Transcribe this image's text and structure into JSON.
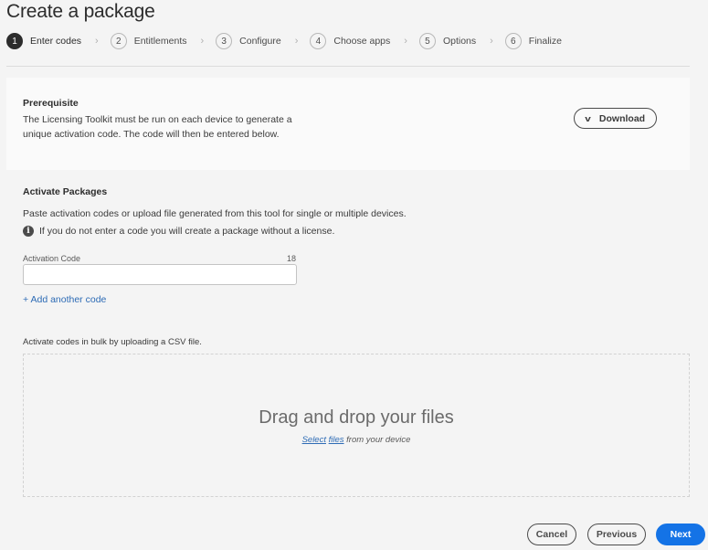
{
  "page": {
    "title": "Create a package"
  },
  "steps": [
    {
      "number": "1",
      "label": "Enter codes",
      "active": true
    },
    {
      "number": "2",
      "label": "Entitlements",
      "active": false
    },
    {
      "number": "3",
      "label": "Configure",
      "active": false
    },
    {
      "number": "4",
      "label": "Choose apps",
      "active": false
    },
    {
      "number": "5",
      "label": "Options",
      "active": false
    },
    {
      "number": "6",
      "label": "Finalize",
      "active": false
    }
  ],
  "step_separator": "›",
  "prerequisite": {
    "title": "Prerequisite",
    "text": "The Licensing Toolkit must be run on each device to generate a unique activation code. The code will then be entered below.",
    "download_icon": "chevron-down-icon",
    "download_label": "Download"
  },
  "activate": {
    "title": "Activate Packages",
    "description": "Paste activation codes or upload file generated from this tool for single or multiple devices.",
    "info_icon": "info-icon",
    "info_text": "If you do not enter a code you will create a package without a license.",
    "field_label": "Activation Code",
    "field_count": "18",
    "field_value": "",
    "field_placeholder": "",
    "add_code_label": "+ Add another code"
  },
  "bulk": {
    "label": "Activate codes in bulk by uploading a CSV file.",
    "drop_title": "Drag and drop your files",
    "select_link_1": "Select",
    "select_link_2": "files",
    "drop_suffix": " from your device"
  },
  "footer": {
    "cancel_label": "Cancel",
    "previous_label": "Previous",
    "next_label": "Next"
  },
  "colors": {
    "accent": "#1473e6",
    "link": "#2d6bb5",
    "background": "#f4f4f4",
    "panel": "#fafafa"
  }
}
